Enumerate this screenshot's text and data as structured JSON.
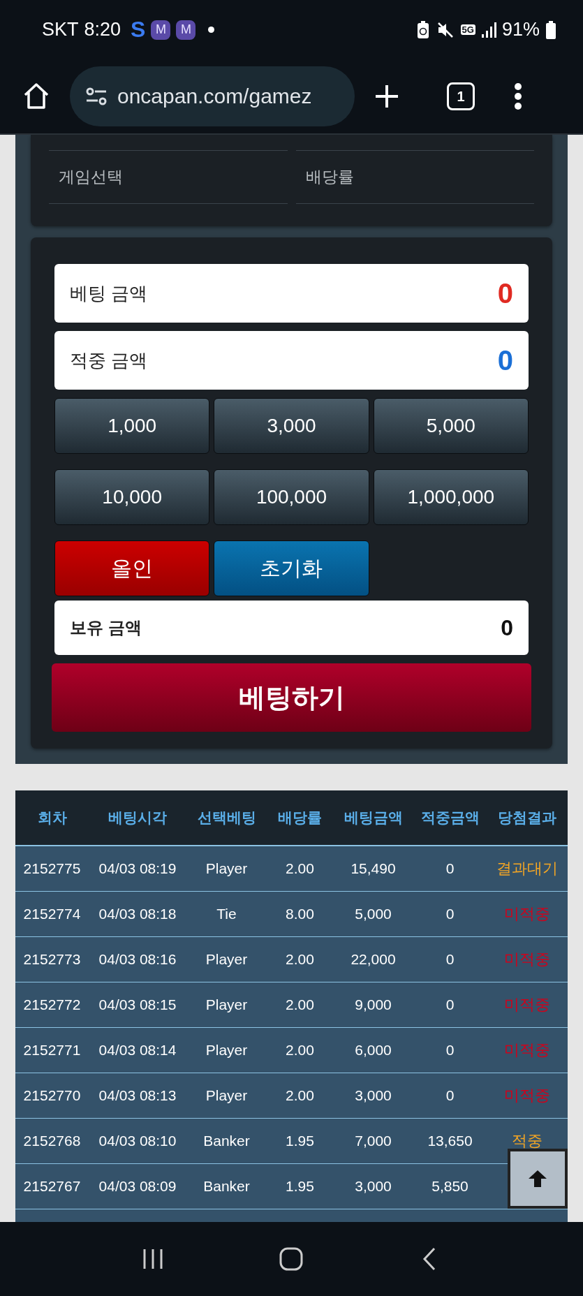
{
  "status_bar": {
    "carrier": "SKT",
    "time": "8:20",
    "app_icons": [
      {
        "letter": "S",
        "kind": "plain"
      },
      {
        "letter": "M",
        "kind": "tile"
      },
      {
        "letter": "M",
        "kind": "tile"
      }
    ],
    "network": "5G",
    "battery": "91%"
  },
  "browser": {
    "url": "oncapan.com/gamez",
    "tab_count": "1"
  },
  "selection": {
    "labels": [
      "게임선택",
      "배당률"
    ]
  },
  "bet_form": {
    "fields": [
      {
        "label": "베팅 금액",
        "value": "0",
        "color": "#e02a22"
      },
      {
        "label": "적중 금액",
        "value": "0",
        "color": "#1a6fd6"
      }
    ],
    "amount_buttons": [
      "1,000",
      "3,000",
      "5,000",
      "10,000",
      "100,000",
      "1,000,000"
    ],
    "action_buttons": [
      {
        "label": "올인",
        "kind": "allin"
      },
      {
        "label": "초기화",
        "kind": "reset"
      }
    ],
    "balance": {
      "label": "보유 금액",
      "value": "0"
    },
    "submit": "베팅하기"
  },
  "history": {
    "columns": [
      "회차",
      "베팅시각",
      "선택베팅",
      "배당률",
      "베팅금액",
      "적중금액",
      "당첨결과"
    ],
    "rows": [
      {
        "cells": [
          "2152775",
          "04/03 08:19",
          "Player",
          "2.00",
          "15,490",
          "0"
        ],
        "result": {
          "text": "결과대기",
          "color": "#f5a623"
        }
      },
      {
        "cells": [
          "2152774",
          "04/03 08:18",
          "Tie",
          "8.00",
          "5,000",
          "0"
        ],
        "result": {
          "text": "미적중",
          "color": "#d0021b"
        }
      },
      {
        "cells": [
          "2152773",
          "04/03 08:16",
          "Player",
          "2.00",
          "22,000",
          "0"
        ],
        "result": {
          "text": "미적중",
          "color": "#d0021b"
        }
      },
      {
        "cells": [
          "2152772",
          "04/03 08:15",
          "Player",
          "2.00",
          "9,000",
          "0"
        ],
        "result": {
          "text": "미적중",
          "color": "#d0021b"
        }
      },
      {
        "cells": [
          "2152771",
          "04/03 08:14",
          "Player",
          "2.00",
          "6,000",
          "0"
        ],
        "result": {
          "text": "미적중",
          "color": "#d0021b"
        }
      },
      {
        "cells": [
          "2152770",
          "04/03 08:13",
          "Player",
          "2.00",
          "3,000",
          "0"
        ],
        "result": {
          "text": "미적중",
          "color": "#d0021b"
        }
      },
      {
        "cells": [
          "2152768",
          "04/03 08:10",
          "Banker",
          "1.95",
          "7,000",
          "13,650"
        ],
        "result": {
          "text": "적중",
          "color": "#f5a623"
        }
      },
      {
        "cells": [
          "2152767",
          "04/03 08:09",
          "Banker",
          "1.95",
          "3,000",
          "5,850"
        ]
      }
    ]
  }
}
